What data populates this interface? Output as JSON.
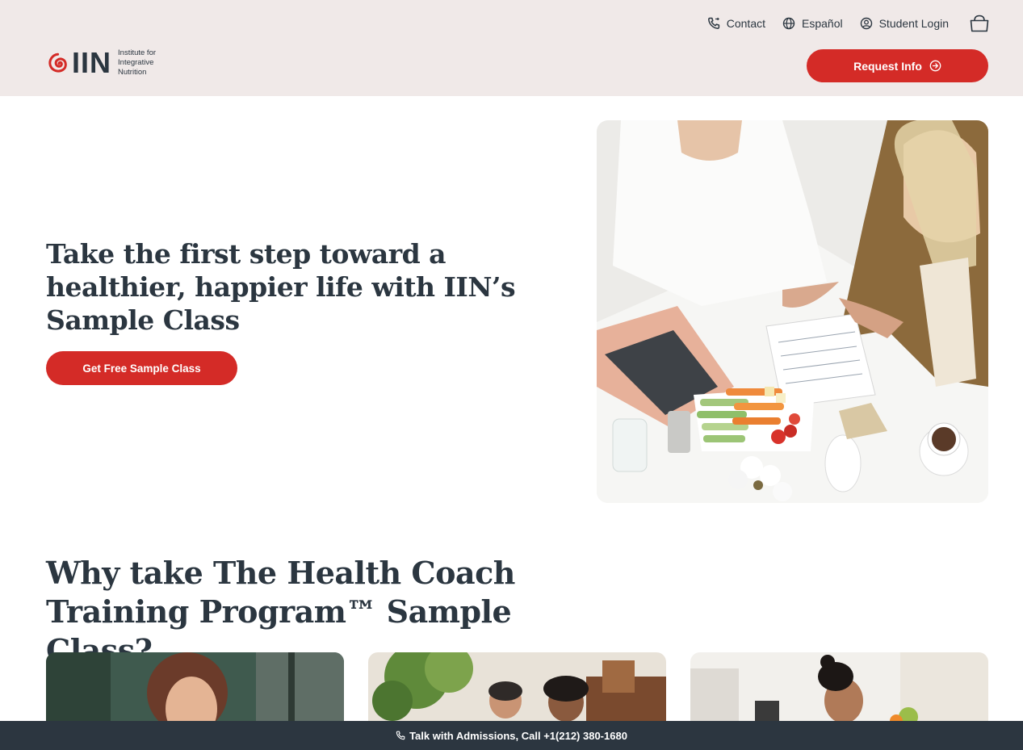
{
  "header": {
    "utility": {
      "contact": "Contact",
      "language": "Español",
      "login": "Student Login"
    },
    "logo": {
      "letters": "IIN",
      "line1": "Institute for",
      "line2": "Integrative",
      "line3": "Nutrition"
    },
    "request_label": "Request Info"
  },
  "hero": {
    "title": "Take the first step toward a healthier, happier life with IIN’s Sample Class",
    "cta_label": "Get Free Sample Class"
  },
  "why": {
    "title": "Why take The Health Coach Training Program™ Sample Class?"
  },
  "bottom_bar": {
    "label": "Talk with Admissions, Call +1(212) 380-1680"
  },
  "colors": {
    "header_bg": "#f0e9e8",
    "accent": "#d42b27",
    "text_dark": "#2b3640",
    "bar_bg": "#2c3640"
  },
  "icons": [
    "phone-icon",
    "globe-icon",
    "user-circle-icon",
    "shopping-bag-icon",
    "arrow-circle-right-icon",
    "spiral-logo-icon"
  ]
}
